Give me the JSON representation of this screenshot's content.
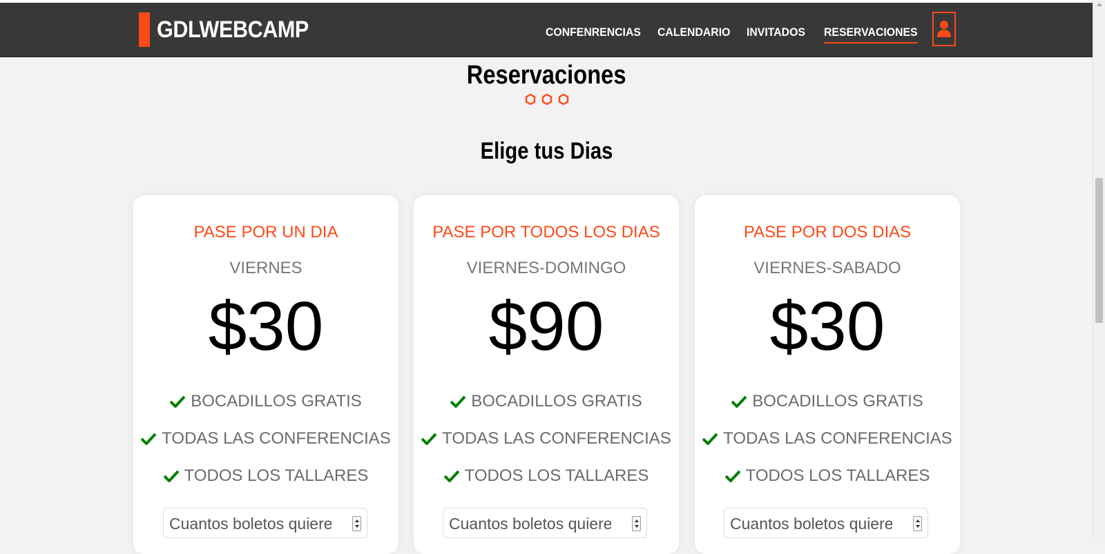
{
  "brand": {
    "name": "GDLWEBCAMP",
    "accent": "#fe4918",
    "nav_bg": "#383838",
    "check_color": "#008000"
  },
  "nav": {
    "items": [
      {
        "label": "CONFENRENCIAS"
      },
      {
        "label": "CALENDARIO"
      },
      {
        "label": "INVITADOS"
      },
      {
        "label": "RESERVACIONES",
        "active": true
      }
    ],
    "user_icon": "user-icon"
  },
  "page": {
    "title": "Reservaciones",
    "section_title": "Elige tus Dias"
  },
  "cards": [
    {
      "title": "PASE POR UN DIA",
      "days": "VIERNES",
      "price": "$30",
      "features": [
        "BOCADILLOS GRATIS",
        "TODAS LAS CONFERENCIAS",
        "TODOS LOS TALLARES"
      ],
      "qty_placeholder": "Cuantos boletos quiere"
    },
    {
      "title": "PASE POR TODOS LOS DIAS",
      "days": "VIERNES-DOMINGO",
      "price": "$90",
      "features": [
        "BOCADILLOS GRATIS",
        "TODAS LAS CONFERENCIAS",
        "TODOS LOS TALLARES"
      ],
      "qty_placeholder": "Cuantos boletos quiere"
    },
    {
      "title": "PASE POR DOS DIAS",
      "days": "VIERNES-SABADO",
      "price": "$30",
      "features": [
        "BOCADILLOS GRATIS",
        "TODAS LAS CONFERENCIAS",
        "TODOS LOS TALLARES"
      ],
      "qty_placeholder": "Cuantos boletos quiere"
    }
  ]
}
